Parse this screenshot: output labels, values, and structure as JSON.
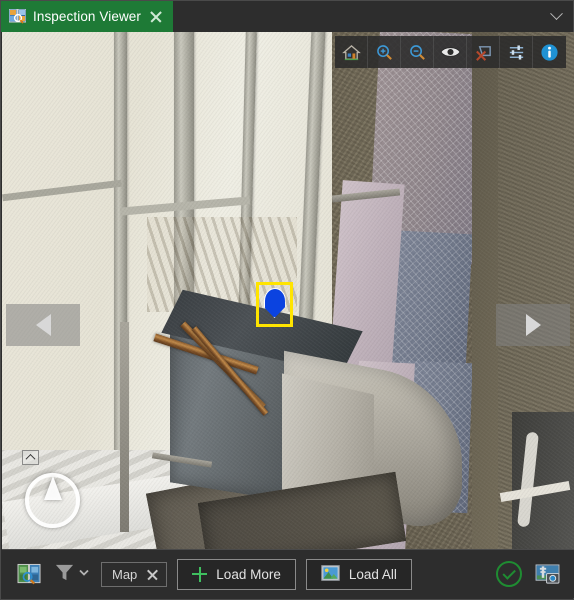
{
  "window": {
    "tab": {
      "title": "Inspection Viewer",
      "icon": "inspection-image-search-icon",
      "close_icon": "close-icon"
    },
    "collapse_icon": "chevron-down-icon"
  },
  "viewer": {
    "image_description": "Aerial inspection photo of a rusted galvanized HVAC exhaust duct and stainless elbow mounted on a building facade with beige panels and a mesh-covered concrete column",
    "toolbar": [
      {
        "name": "home-icon",
        "label": "Home"
      },
      {
        "name": "zoom-in-icon",
        "label": "Zoom In"
      },
      {
        "name": "zoom-out-icon",
        "label": "Zoom Out"
      },
      {
        "name": "eye-icon",
        "label": "Show / Hide Annotations"
      },
      {
        "name": "delete-shape-icon",
        "label": "Delete Shape"
      },
      {
        "name": "sliders-icon",
        "label": "Image Adjustments"
      },
      {
        "name": "info-icon",
        "label": "Image Info"
      }
    ],
    "nav": {
      "prev_icon": "chevron-left-icon",
      "next_icon": "chevron-right-icon"
    },
    "compass": {
      "icon": "compass-north-icon",
      "collapse_icon": "chevron-up-icon"
    },
    "marker": {
      "icon": "map-pin-icon",
      "pin_color": "#0b43e0",
      "selection_color": "#ffe400"
    }
  },
  "bottombar": {
    "layers_icon": "map-image-search-icon",
    "filter_icon": "filter-funnel-icon",
    "filter_chevron_icon": "chevron-down-icon",
    "chip": {
      "label": "Map",
      "close_icon": "close-icon"
    },
    "load_more": {
      "label": "Load More",
      "icon": "plus-icon"
    },
    "load_all": {
      "label": "Load All",
      "icon": "image-icon"
    },
    "confirm": {
      "icon": "check-circle-icon",
      "color": "#1f8c32"
    },
    "camera_tool_icon": "tower-camera-icon"
  },
  "colors": {
    "tab_green": "#1e7a36",
    "chrome": "#2d2d2d",
    "accent_blue": "#2196d6",
    "confirm_green": "#1f8c32",
    "marker_blue": "#0b43e0",
    "selection_yellow": "#ffe400"
  }
}
